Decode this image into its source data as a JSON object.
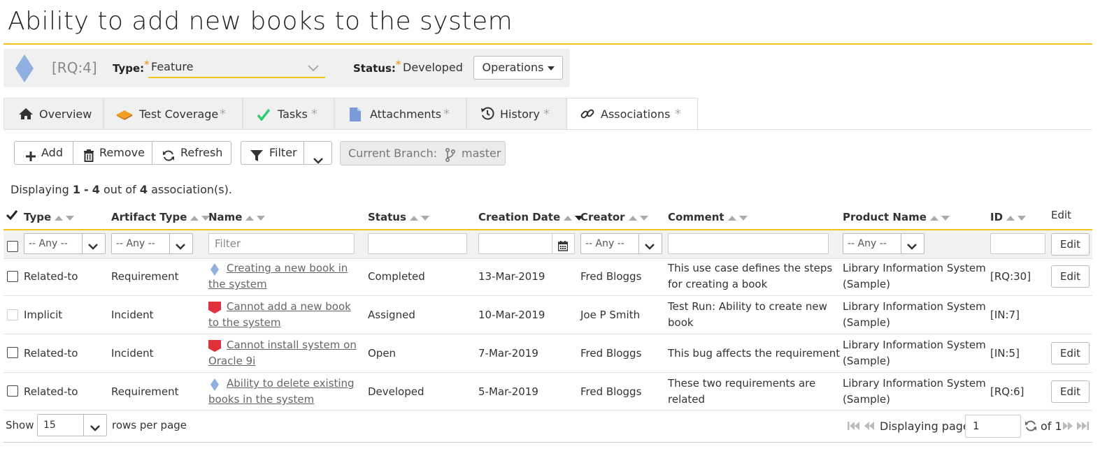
{
  "page": {
    "title": "Ability to add new books to the system"
  },
  "header": {
    "token": "[RQ:4]",
    "type_label": "Type:",
    "type_value": "Feature",
    "status_label": "Status:",
    "status_value": "Developed",
    "required_marker": "*",
    "operations_label": "Operations"
  },
  "tabs": [
    {
      "label": "Overview",
      "icon": "home-icon",
      "dirty": ""
    },
    {
      "label": "Test Coverage",
      "icon": "test-coverage-icon",
      "dirty": "*"
    },
    {
      "label": "Tasks",
      "icon": "check-icon",
      "dirty": "*"
    },
    {
      "label": "Attachments",
      "icon": "document-icon",
      "dirty": "*"
    },
    {
      "label": "History",
      "icon": "history-icon",
      "dirty": "*"
    },
    {
      "label": "Associations",
      "icon": "link-icon",
      "dirty": "*",
      "active": true
    }
  ],
  "toolbar": {
    "add_label": "Add",
    "remove_label": "Remove",
    "refresh_label": "Refresh",
    "filter_label": "Filter",
    "branch_label": "Current Branch:",
    "branch_value": "master"
  },
  "summary": {
    "prefix": "Displaying",
    "start": "1",
    "dash": "-",
    "end": "4",
    "mid": "out of",
    "total": "4",
    "suffix": "association(s)."
  },
  "columns": {
    "type": "Type",
    "artifact_type": "Artifact Type",
    "name": "Name",
    "status": "Status",
    "creation_date": "Creation Date",
    "creator": "Creator",
    "comment": "Comment",
    "product_name": "Product Name",
    "id": "ID",
    "edit": "Edit"
  },
  "filters": {
    "any": "-- Any --",
    "name_placeholder": "Filter",
    "edit_label": "Edit"
  },
  "rows": [
    {
      "type": "Related-to",
      "artifact_type": "Requirement",
      "artifact_icon": "requirement-icon",
      "name": "Creating a new book in the system",
      "status": "Completed",
      "date": "13-Mar-2019",
      "creator": "Fred Bloggs",
      "comment": "This use case defines the steps for creating a book",
      "product": "Library Information System (Sample)",
      "id": "[RQ:30]",
      "edit": "Edit"
    },
    {
      "type": "Implicit",
      "artifact_type": "Incident",
      "artifact_icon": "incident-icon",
      "name": "Cannot add a new book to the system",
      "status": "Assigned",
      "date": "10-Mar-2019",
      "creator": "Joe P Smith",
      "comment": "Test Run: Ability to create new book",
      "product": "Library Information System (Sample)",
      "id": "[IN:7]",
      "edit": ""
    },
    {
      "type": "Related-to",
      "artifact_type": "Incident",
      "artifact_icon": "incident-icon",
      "name": "Cannot install system on Oracle 9i",
      "status": "Open",
      "date": "7-Mar-2019",
      "creator": "Fred Bloggs",
      "comment": "This bug affects the requirement",
      "product": "Library Information System (Sample)",
      "id": "[IN:5]",
      "edit": "Edit"
    },
    {
      "type": "Related-to",
      "artifact_type": "Requirement",
      "artifact_icon": "requirement-icon",
      "name": "Ability to delete existing books in the system",
      "status": "Developed",
      "date": "5-Mar-2019",
      "creator": "Fred Bloggs",
      "comment": "These two requirements are related",
      "product": "Library Information System (Sample)",
      "id": "[RQ:6]",
      "edit": "Edit"
    }
  ],
  "footer": {
    "show_label": "Show",
    "rows_value": "15",
    "rows_suffix": "rows per page",
    "displaying_page": "Displaying page",
    "page_value": "1",
    "of_label": "of 1"
  },
  "colors": {
    "accent": "#f0c419",
    "requirement": "#8fb0e0",
    "incident": "#e0303a"
  }
}
